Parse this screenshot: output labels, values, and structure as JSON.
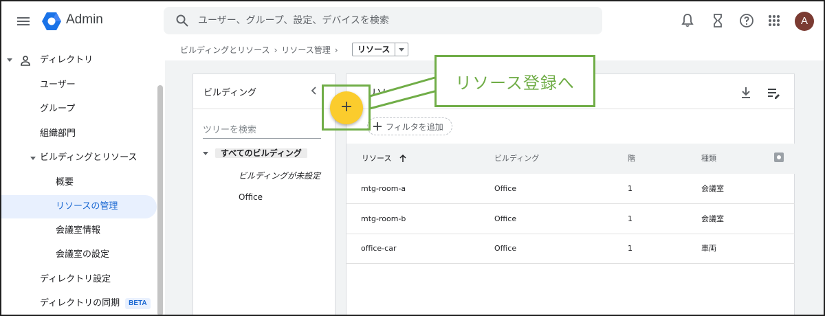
{
  "header": {
    "app_title": "Admin",
    "search_placeholder": "ユーザー、グループ、設定、デバイスを検索",
    "avatar_initial": "A",
    "brand_color": "#1a73e8",
    "icons": [
      "menu-icon",
      "admin-logo-icon",
      "search-icon",
      "bell-icon",
      "hourglass-icon",
      "help-icon",
      "apps-icon"
    ]
  },
  "sidebar": {
    "directory_label": "ディレクトリ",
    "items": [
      {
        "label": "ユーザー"
      },
      {
        "label": "グループ"
      },
      {
        "label": "組織部門"
      },
      {
        "label": "ビルディングとリソース"
      },
      {
        "label": "概要"
      },
      {
        "label": "リソースの管理"
      },
      {
        "label": "会議室情報"
      },
      {
        "label": "会議室の設定"
      },
      {
        "label": "ディレクトリ設定"
      },
      {
        "label": "ディレクトリの同期"
      }
    ],
    "beta_badge": "BETA"
  },
  "breadcrumb": {
    "items": [
      "ビルディングとリソース",
      "リソース管理"
    ],
    "current": "リソース"
  },
  "buildings_panel": {
    "title": "ビルディング",
    "tree_search_placeholder": "ツリーを検索",
    "tree": {
      "root": "すべてのビルディング",
      "children": [
        "ビルディングが未設定",
        "Office"
      ]
    }
  },
  "resources_panel": {
    "title": "リソース",
    "filter_label": "フィルタを追加",
    "columns": [
      "リソース",
      "ビルディング",
      "階",
      "種類"
    ],
    "rows": [
      {
        "name": "mtg-room-a",
        "building": "Office",
        "floor": "1",
        "type": "会議室"
      },
      {
        "name": "mtg-room-b",
        "building": "Office",
        "floor": "1",
        "type": "会議室"
      },
      {
        "name": "office-car",
        "building": "Office",
        "floor": "1",
        "type": "車両"
      }
    ]
  },
  "fab": {
    "label": "+",
    "color": "#fbcc2d"
  },
  "annotation": {
    "text": "リソース登録へ",
    "color": "#70ad47"
  }
}
